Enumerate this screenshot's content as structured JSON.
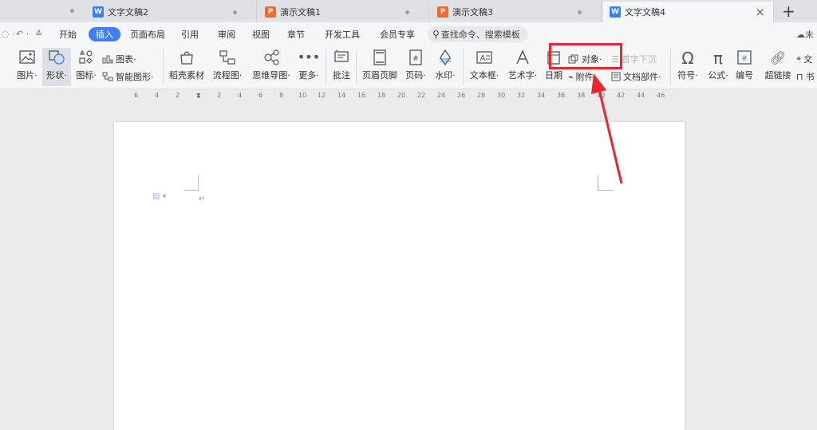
{
  "tabs": [
    {
      "label": "文字文稿2",
      "type": "W",
      "active": false
    },
    {
      "label": "演示文稿1",
      "type": "P",
      "active": false
    },
    {
      "label": "演示文稿3",
      "type": "P",
      "active": false
    },
    {
      "label": "文字文稿4",
      "type": "W",
      "active": true
    }
  ],
  "tab_close": "×",
  "new_tab": "+",
  "menu": {
    "items": [
      "开始",
      "插入",
      "页面布局",
      "引用",
      "审阅",
      "视图",
      "章节",
      "开发工具",
      "会员专享"
    ],
    "active": "插入",
    "search_placeholder": "查找命令、搜索模板",
    "cloud_label": "未"
  },
  "ribbon": {
    "picture": "图片",
    "shape": "形状",
    "icon": "图标",
    "chart": "图表",
    "smart_shape": "智能图形",
    "docer_material": "稻壳素材",
    "flowchart": "流程图",
    "mindmap": "思维导图",
    "more": "更多",
    "comment": "批注",
    "header_footer": "页眉页脚",
    "page_number": "页码",
    "watermark": "水印",
    "text_box": "文本框",
    "word_art": "艺术字",
    "date": "日期",
    "object": "对象",
    "attachment": "附件",
    "drop_cap": "首字下沉",
    "doc_parts": "文档部件",
    "symbol": "符号",
    "formula": "公式",
    "numbering": "编号",
    "hyperlink": "超链接",
    "cross_ref": "文",
    "bookmark": "书"
  },
  "ruler_labels": [
    "6",
    "4",
    "2",
    "2",
    "4",
    "6",
    "8",
    "10",
    "12",
    "14",
    "16",
    "18",
    "20",
    "22",
    "24",
    "26",
    "28",
    "30",
    "32",
    "34",
    "36",
    "38",
    "40",
    "42",
    "44",
    "46"
  ],
  "page": {
    "paragraph_mark": "↵"
  },
  "colors": {
    "accent": "#3e80f4",
    "annotation": "#e8262d",
    "word_icon": "#3b7ff0",
    "ppt_icon": "#ee6a32"
  }
}
